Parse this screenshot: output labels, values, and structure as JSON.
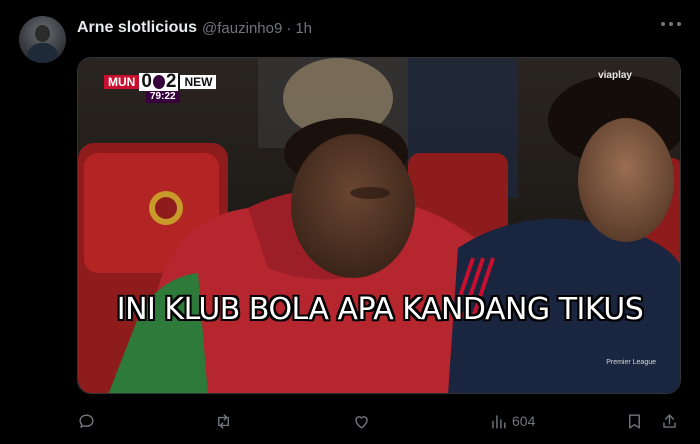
{
  "tweet": {
    "display_name": "Arne slotlicious",
    "handle": "@fauzinho9",
    "separator": "·",
    "time": "1h"
  },
  "media": {
    "scorebug": {
      "home": "MUN",
      "home_score": "0",
      "away_score": "2",
      "away": "NEW",
      "clock": "79:22"
    },
    "broadcaster": "viaplay",
    "league_mark": "Premier League",
    "caption": "INI KLUB BOLA APA KANDANG TIKUS"
  },
  "actions": {
    "views_count": "604"
  },
  "icons": [
    "more-icon",
    "reply-icon",
    "repost-icon",
    "like-icon",
    "views-icon",
    "bookmark-icon",
    "share-icon"
  ],
  "colors": {
    "background": "#000000",
    "text_primary": "#e7e9ea",
    "text_secondary": "#71767b",
    "scorebug_home": "#c8102e",
    "scorebug_clock": "#37003c"
  }
}
